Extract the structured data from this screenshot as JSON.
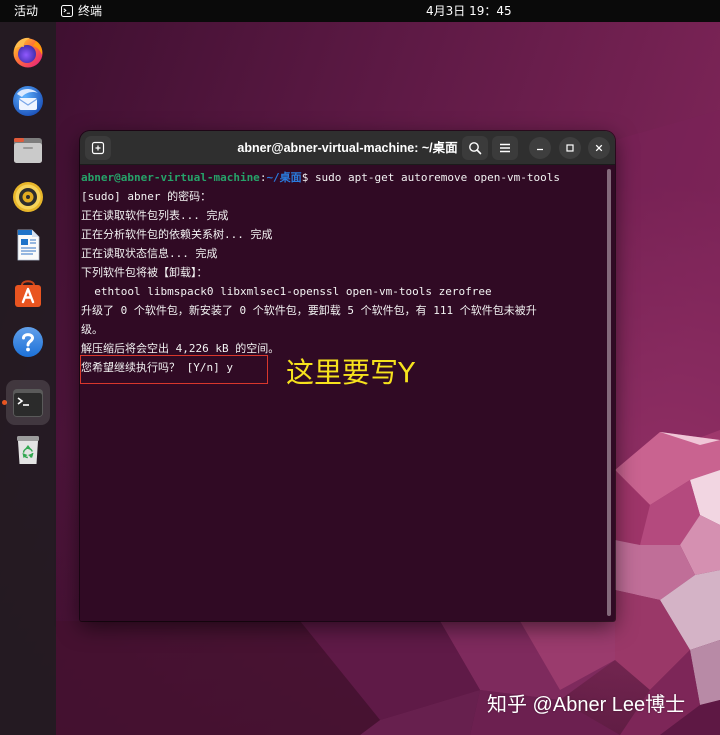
{
  "topbar": {
    "activities_label": "活动",
    "app_icon": "terminal-icon",
    "app_label": "终端",
    "clock": "4月3日 19：45"
  },
  "dock": {
    "icons": [
      "firefox-icon",
      "thunderbird-icon",
      "files-icon",
      "rhythmbox-icon",
      "libreoffice-writer-icon",
      "ubuntu-software-icon",
      "help-icon",
      "terminal-icon",
      "trash-icon"
    ],
    "active": "terminal-icon"
  },
  "terminal": {
    "title": "abner@abner-virtual-machine: ~/桌面",
    "header_icons": [
      "new-tab-icon",
      "search-icon",
      "menu-icon",
      "minimize-icon",
      "maximize-icon",
      "close-icon"
    ],
    "prompt": {
      "user_host": "abner@abner-virtual-machine",
      "separator": ":",
      "path": "~/桌面",
      "symbol": "$",
      "command": "sudo apt-get autoremove open-vm-tools"
    },
    "output": [
      "[sudo] abner 的密码：",
      "正在读取软件包列表... 完成",
      "正在分析软件包的依赖关系树... 完成",
      "正在读取状态信息... 完成",
      "下列软件包将被【卸载】：",
      "  ethtool libmspack0 libxmlsec1-openssl open-vm-tools zerofree",
      "升级了 0 个软件包，新安装了 0 个软件包，要卸载 5 个软件包，有 111 个软件包未被升",
      "级。",
      "解压缩后将会空出 4,226 kB 的空间。",
      "您希望继续执行吗？ [Y/n] y"
    ]
  },
  "annotation": {
    "text": "这里要写Y"
  },
  "watermark": "知乎 @Abner Lee博士",
  "colors": {
    "terminal_bg": "#300a24",
    "terminal_fg": "#f2f2f2",
    "prompt_user_host": "#26a269",
    "prompt_path": "#2a7bde",
    "annotation_text": "#f6e21d",
    "annotation_box": "#d8372c",
    "accent": "#e95420",
    "titlebar_bg": "#2f2f2f"
  }
}
